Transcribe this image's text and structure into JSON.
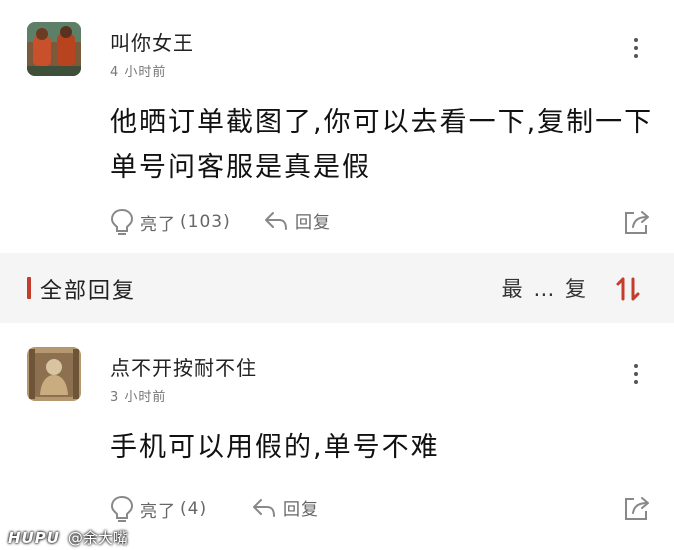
{
  "post1": {
    "username": "叫你女王",
    "time": "4 小时前",
    "content": "他晒订单截图了,你可以去看一下,复制一下单号问客服是真是假",
    "like_label": "亮了",
    "like_count": "(103)",
    "reply_label": "回复",
    "icons": [
      "more-vertical-icon",
      "lightbulb-icon",
      "reply-arrow-icon",
      "share-icon"
    ]
  },
  "section_bar": {
    "title": "全部回复",
    "sort_label": "最 … 复",
    "accent_color": "#c43c2c"
  },
  "post2": {
    "username": "点不开按耐不住",
    "time": "3 小时前",
    "content": "手机可以用假的,单号不难",
    "like_label": "亮了",
    "like_count": "(4)",
    "reply_label": "回复"
  },
  "watermark": {
    "logo": "HUPU",
    "handle": "@余大嘴"
  }
}
